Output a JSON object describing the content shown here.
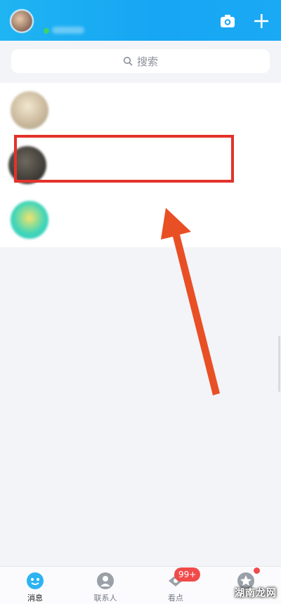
{
  "search": {
    "placeholder": "搜索"
  },
  "chats": [
    {
      "name": "",
      "message": "",
      "time": ""
    },
    {
      "name": "",
      "message": "",
      "time": ""
    },
    {
      "name": "",
      "message": "",
      "time": ""
    }
  ],
  "tabs": [
    {
      "label": "消息"
    },
    {
      "label": "联系人"
    },
    {
      "label": "看点"
    },
    {
      "label": ""
    }
  ],
  "badge": {
    "count": "99+"
  },
  "watermark": "湖南龙网",
  "colors": {
    "header": "#17a6f3",
    "highlight": "#e3322b",
    "badge": "#f04a4a"
  },
  "icons": {
    "camera": "camera-icon",
    "plus": "plus-icon",
    "search": "search-icon"
  }
}
